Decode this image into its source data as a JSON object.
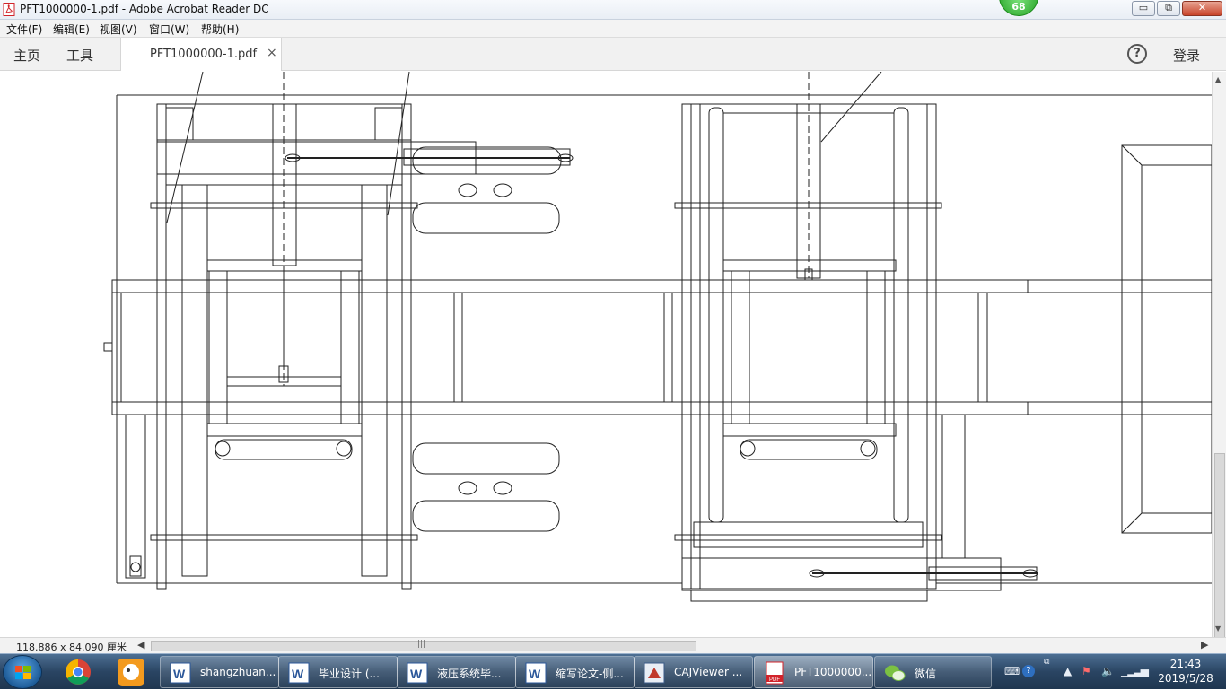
{
  "window": {
    "title": "PFT1000000-1.pdf - Adobe Acrobat Reader DC",
    "badge": "68",
    "min_glyph": "▭",
    "max_glyph": "⧉",
    "close_glyph": "✕"
  },
  "menu": {
    "items": [
      "文件(F)",
      "编辑(E)",
      "视图(V)",
      "窗口(W)",
      "帮助(H)"
    ]
  },
  "tabs": {
    "home": "主页",
    "tools": "工具",
    "doc": "PFT1000000-1.pdf",
    "doc_close": "×",
    "help": "?",
    "login": "登录"
  },
  "status": {
    "page_size": "118.886 x 84.090 厘米",
    "left_arrow": "◀",
    "right_arrow": "▶",
    "grip": "|||"
  },
  "taskbar": {
    "items": [
      {
        "label": "shangzhuan...",
        "icon": "word-icon"
      },
      {
        "label": "毕业设计 (...",
        "icon": "word-icon"
      },
      {
        "label": "液压系统毕...",
        "icon": "word-icon"
      },
      {
        "label": "缩写论文-侧...",
        "icon": "word-icon"
      },
      {
        "label": "CAJViewer ...",
        "icon": "cajviewer-icon"
      },
      {
        "label": "PFT1000000...",
        "icon": "pdf-icon"
      },
      {
        "label": "微信",
        "icon": "wechat-icon"
      }
    ],
    "time": "21:43",
    "date": "2019/5/28"
  },
  "colors": {
    "taskbar": "#2a4563",
    "pdf_red": "#d2232a",
    "badge_green": "#23a023"
  }
}
